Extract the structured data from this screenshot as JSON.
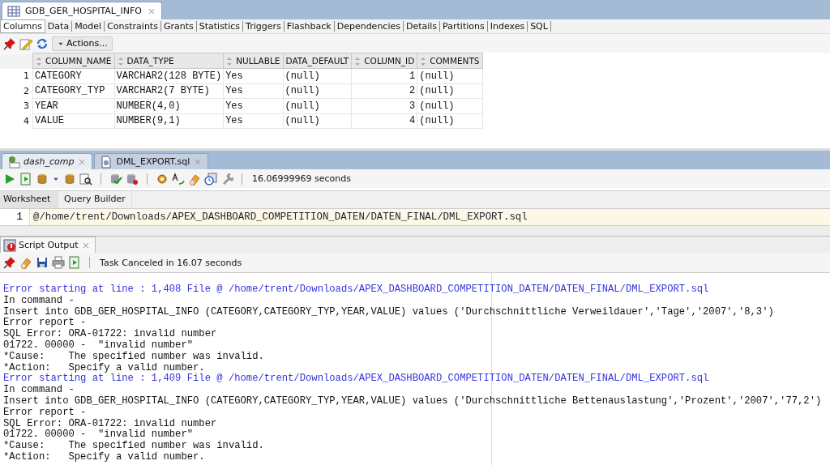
{
  "object_tab": {
    "title": "GDB_GER_HOSPITAL_INFO",
    "selected": true
  },
  "sub_tabs": [
    {
      "label": "Columns",
      "selected": true
    },
    {
      "label": "Data",
      "selected": false
    },
    {
      "label": "Model",
      "selected": false
    },
    {
      "label": "Constraints",
      "selected": false
    },
    {
      "label": "Grants",
      "selected": false
    },
    {
      "label": "Statistics",
      "selected": false
    },
    {
      "label": "Triggers",
      "selected": false
    },
    {
      "label": "Flashback",
      "selected": false
    },
    {
      "label": "Dependencies",
      "selected": false
    },
    {
      "label": "Details",
      "selected": false
    },
    {
      "label": "Partitions",
      "selected": false
    },
    {
      "label": "Indexes",
      "selected": false
    },
    {
      "label": "SQL",
      "selected": false
    }
  ],
  "actions_button": "Actions...",
  "table": {
    "columns": [
      {
        "label": "COLUMN_NAME",
        "sort_icon": true,
        "kind": "text"
      },
      {
        "label": "DATA_TYPE",
        "sort_icon": true,
        "kind": "text"
      },
      {
        "label": "NULLABLE",
        "sort_icon": true,
        "kind": "text"
      },
      {
        "label": "DATA_DEFAULT",
        "sort_icon": false,
        "kind": "text"
      },
      {
        "label": "COLUMN_ID",
        "sort_icon": true,
        "kind": "number"
      },
      {
        "label": "COMMENTS",
        "sort_icon": true,
        "kind": "text"
      }
    ],
    "rows": [
      {
        "number": "1",
        "cells": [
          "CATEGORY",
          "VARCHAR2(128 BYTE)",
          "Yes",
          "(null)",
          "1",
          "(null)"
        ]
      },
      {
        "number": "2",
        "cells": [
          "CATEGORY_TYP",
          "VARCHAR2(7 BYTE)",
          "Yes",
          "(null)",
          "2",
          "(null)"
        ]
      },
      {
        "number": "3",
        "cells": [
          "YEAR",
          "NUMBER(4,0)",
          "Yes",
          "(null)",
          "3",
          "(null)"
        ]
      },
      {
        "number": "4",
        "cells": [
          "VALUE",
          "NUMBER(9,1)",
          "Yes",
          "(null)",
          "4",
          "(null)"
        ]
      }
    ]
  },
  "editor_tabs": [
    {
      "label": "dash_comp",
      "kind": "connection",
      "selected": true
    },
    {
      "label": "DML_EXPORT.sql",
      "kind": "file",
      "selected": false
    }
  ],
  "elapsed_time": "16.06999969 seconds",
  "worksheet_tabs": [
    {
      "label": "Worksheet",
      "selected": true
    },
    {
      "label": "Query Builder",
      "selected": false
    }
  ],
  "editor_lines": [
    {
      "number": "1",
      "text": "@/home/trent/Downloads/APEX_DASHBOARD_COMPETITION_DATEN/DATEN_FINAL/DML_EXPORT.sql",
      "current": true
    }
  ],
  "output_tab": {
    "label": "Script Output",
    "selected": true
  },
  "task_status": "Task Canceled in 16.07 seconds",
  "output_lines": [
    {
      "kind": "error",
      "text": "Error starting at line : 1,408 File @ /home/trent/Downloads/APEX_DASHBOARD_COMPETITION_DATEN/DATEN_FINAL/DML_EXPORT.sql"
    },
    {
      "kind": "plain",
      "text": "In command -"
    },
    {
      "kind": "plain",
      "text": "Insert into GDB_GER_HOSPITAL_INFO (CATEGORY,CATEGORY_TYP,YEAR,VALUE) values ('Durchschnittliche Verweildauer','Tage','2007','8,3')"
    },
    {
      "kind": "plain",
      "text": "Error report -"
    },
    {
      "kind": "plain",
      "text": "SQL Error: ORA-01722: invalid number"
    },
    {
      "kind": "plain",
      "text": "01722. 00000 -  \"invalid number\""
    },
    {
      "kind": "plain",
      "text": "*Cause:    The specified number was invalid."
    },
    {
      "kind": "plain",
      "text": "*Action:   Specify a valid number."
    },
    {
      "kind": "error",
      "text": "Error starting at line : 1,409 File @ /home/trent/Downloads/APEX_DASHBOARD_COMPETITION_DATEN/DATEN_FINAL/DML_EXPORT.sql"
    },
    {
      "kind": "plain",
      "text": "In command -"
    },
    {
      "kind": "plain",
      "text": "Insert into GDB_GER_HOSPITAL_INFO (CATEGORY,CATEGORY_TYP,YEAR,VALUE) values ('Durchschnittliche Bettenauslastung','Prozent','2007','77,2')"
    },
    {
      "kind": "plain",
      "text": "Error report -"
    },
    {
      "kind": "plain",
      "text": "SQL Error: ORA-01722: invalid number"
    },
    {
      "kind": "plain",
      "text": "01722. 00000 -  \"invalid number\""
    },
    {
      "kind": "plain",
      "text": "*Cause:    The specified number was invalid."
    },
    {
      "kind": "plain",
      "text": "*Action:   Specify a valid number."
    }
  ]
}
